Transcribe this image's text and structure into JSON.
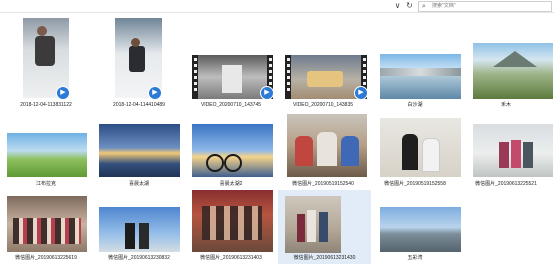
{
  "toolbar": {
    "dropdown_glyph": "∨",
    "refresh_glyph": "↻",
    "search_placeholder": "搜索\"文档\""
  },
  "items": [
    {
      "id": "a1",
      "caption": "2018-12-04-113831122",
      "type": "video-portrait"
    },
    {
      "id": "a2",
      "caption": "2018-12-04-114410489",
      "type": "video-portrait"
    },
    {
      "id": "a3",
      "caption": "VIDEO_20200710_143745",
      "type": "video"
    },
    {
      "id": "a4",
      "caption": "VIDEO_20200710_143835",
      "type": "video"
    },
    {
      "id": "a5",
      "caption": "白沙湖",
      "type": "image"
    },
    {
      "id": "a6",
      "caption": "禾木",
      "type": "image"
    },
    {
      "id": "b1",
      "caption": "江布拉克",
      "type": "image"
    },
    {
      "id": "b2",
      "caption": "喜晨太湖",
      "type": "image"
    },
    {
      "id": "b3",
      "caption": "喜晨太湖2",
      "type": "image"
    },
    {
      "id": "b4",
      "caption": "微信图片_20190519152540",
      "type": "image"
    },
    {
      "id": "b5",
      "caption": "微信图片_20190519152558",
      "type": "image"
    },
    {
      "id": "b6",
      "caption": "微信图片_20190613225521",
      "type": "image"
    },
    {
      "id": "c1",
      "caption": "微信图片_20190613225619",
      "type": "image"
    },
    {
      "id": "c2",
      "caption": "微信图片_20190613230832",
      "type": "image"
    },
    {
      "id": "c3",
      "caption": "微信图片_20190613231403",
      "type": "image"
    },
    {
      "id": "c4",
      "caption": "微信图片_20190613231430",
      "type": "image",
      "selected": true
    },
    {
      "id": "c5",
      "caption": "五彩湾",
      "type": "image"
    }
  ]
}
